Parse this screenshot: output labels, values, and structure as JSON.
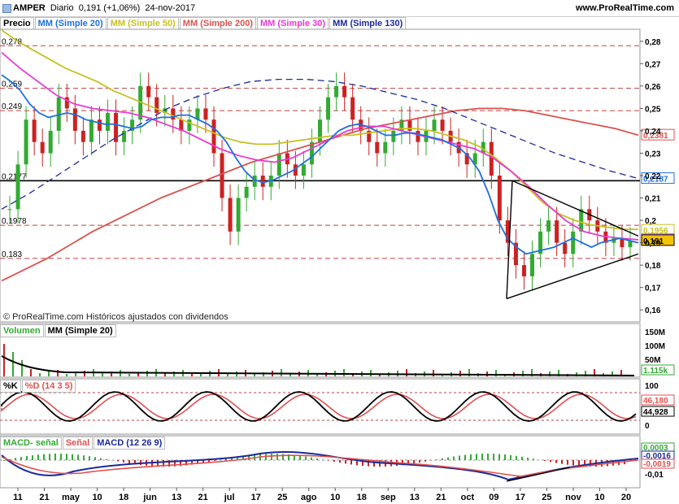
{
  "header": {
    "ticker": "AMPER",
    "period": "Diario",
    "last": "0,191 (+1,06%)",
    "date": "24-nov-2017",
    "site": "www.ProRealTime.com"
  },
  "copyright": "© ProRealTime.com  Históricos ajustados con dividendos",
  "colors": {
    "candle_up": "#33aa33",
    "candle_down": "#cc2222",
    "ma20": "#1f6fe0",
    "ma50": "#c8c020",
    "ma200": "#d9534f",
    "ma30": "#e83ad1",
    "ma130": "#1a2a9a"
  },
  "chart_data": [
    {
      "type": "candlestick",
      "title": "AMPER Diario",
      "legend": [
        "Precio",
        "MM (Simple 20)",
        "MM (Simple 50)",
        "MM (Simple 200)",
        "MM (Simple 30)",
        "MM (Simple 130)"
      ],
      "ylim": [
        0.155,
        0.285
      ],
      "yticks": [
        "0,28",
        "0,27",
        "0,26",
        "0,25",
        "0,24",
        "0,23",
        "0,22",
        "0,21",
        "0,2",
        "0,19",
        "0,18",
        "0,17",
        "0,16"
      ],
      "x_labels": [
        "11",
        "21",
        "may",
        "10",
        "18",
        "jun",
        "13",
        "21",
        "jul",
        "17",
        "25",
        "ago",
        "10",
        "18",
        "sep",
        "13",
        "21",
        "oct",
        "09",
        "17",
        "25",
        "nov",
        "10",
        "20"
      ],
      "h_levels": [
        {
          "value": 0.278,
          "label": "0,278",
          "style": "dashed"
        },
        {
          "value": 0.259,
          "label": "0,259",
          "style": "dashed"
        },
        {
          "value": 0.249,
          "label": "0,249",
          "style": "dashed"
        },
        {
          "value": 0.2177,
          "label": "0,2177",
          "style": "solid"
        },
        {
          "value": 0.1978,
          "label": "0,1978",
          "style": "dashed"
        },
        {
          "value": 0.183,
          "label": "0,183",
          "style": "dashed"
        }
      ],
      "right_tags": [
        {
          "value": 0.2381,
          "label": "0,2381"
        },
        {
          "value": 0.2187,
          "label": "0,2187"
        },
        {
          "value": 0.1956,
          "label": "0,1956"
        },
        {
          "value": 0.1914,
          "label": "0,1914"
        },
        {
          "value": 0.191,
          "label": "0,191"
        }
      ],
      "close": [
        0.205,
        0.225,
        0.245,
        0.235,
        0.23,
        0.24,
        0.255,
        0.25,
        0.24,
        0.235,
        0.245,
        0.24,
        0.248,
        0.235,
        0.24,
        0.245,
        0.26,
        0.255,
        0.248,
        0.25,
        0.245,
        0.24,
        0.245,
        0.25,
        0.245,
        0.23,
        0.21,
        0.195,
        0.21,
        0.215,
        0.22,
        0.215,
        0.22,
        0.23,
        0.225,
        0.22,
        0.225,
        0.235,
        0.245,
        0.255,
        0.26,
        0.255,
        0.245,
        0.24,
        0.235,
        0.23,
        0.235,
        0.24,
        0.245,
        0.24,
        0.235,
        0.24,
        0.245,
        0.24,
        0.235,
        0.23,
        0.225,
        0.23,
        0.235,
        0.22,
        0.2,
        0.19,
        0.18,
        0.175,
        0.185,
        0.195,
        0.2,
        0.19,
        0.185,
        0.195,
        0.205,
        0.2,
        0.195,
        0.19,
        0.192,
        0.188,
        0.191
      ],
      "ma20": [
        0.265,
        0.262,
        0.258,
        0.252,
        0.248,
        0.246,
        0.247,
        0.248,
        0.247,
        0.245,
        0.244,
        0.243,
        0.243,
        0.242,
        0.241,
        0.242,
        0.245,
        0.246,
        0.246,
        0.247,
        0.247,
        0.245,
        0.243,
        0.24,
        0.235,
        0.228,
        0.222,
        0.218,
        0.217,
        0.218,
        0.22,
        0.222,
        0.225,
        0.228,
        0.232,
        0.236,
        0.24,
        0.242,
        0.243,
        0.242,
        0.24,
        0.238,
        0.238,
        0.239,
        0.239,
        0.238,
        0.237,
        0.236,
        0.234,
        0.232,
        0.228,
        0.222,
        0.212,
        0.2,
        0.192,
        0.188,
        0.185,
        0.186,
        0.187,
        0.188,
        0.19,
        0.192,
        0.19,
        0.188,
        0.19,
        0.191,
        0.192,
        0.191,
        0.19
      ],
      "ma50": [
        0.285,
        0.28,
        0.276,
        0.272,
        0.268,
        0.265,
        0.262,
        0.258,
        0.255,
        0.252,
        0.249,
        0.246,
        0.243,
        0.24,
        0.237,
        0.235,
        0.234,
        0.234,
        0.235,
        0.236,
        0.237,
        0.238,
        0.238,
        0.239,
        0.24,
        0.241,
        0.241,
        0.24,
        0.238,
        0.236,
        0.233,
        0.228,
        0.222,
        0.215,
        0.208,
        0.203,
        0.2,
        0.198,
        0.197,
        0.196,
        0.196
      ],
      "ma200": [
        0.173,
        0.178,
        0.183,
        0.189,
        0.195,
        0.2,
        0.205,
        0.21,
        0.214,
        0.218,
        0.222,
        0.226,
        0.229,
        0.232,
        0.235,
        0.238,
        0.241,
        0.243,
        0.245,
        0.247,
        0.249,
        0.25,
        0.25,
        0.249,
        0.247,
        0.245,
        0.243,
        0.241,
        0.2381
      ],
      "ma30": [
        0.275,
        0.268,
        0.262,
        0.256,
        0.252,
        0.25,
        0.249,
        0.248,
        0.246,
        0.243,
        0.24,
        0.236,
        0.232,
        0.229,
        0.227,
        0.226,
        0.228,
        0.232,
        0.236,
        0.24,
        0.242,
        0.242,
        0.24,
        0.238,
        0.236,
        0.234,
        0.232,
        0.228,
        0.222,
        0.215,
        0.207,
        0.2,
        0.195,
        0.193,
        0.192,
        0.1914
      ],
      "ma130": [
        0.205,
        0.212,
        0.22,
        0.228,
        0.236,
        0.243,
        0.25,
        0.255,
        0.259,
        0.262,
        0.263,
        0.263,
        0.262,
        0.26,
        0.257,
        0.254,
        0.25,
        0.245,
        0.24,
        0.235,
        0.23,
        0.226,
        0.222,
        0.2187
      ]
    },
    {
      "type": "bar",
      "title": "Volumen",
      "legend": [
        "Volumen",
        "MM (Simple 20)"
      ],
      "yticks": [
        "150M",
        "100M",
        "50M"
      ],
      "last_tag": "1.115k"
    },
    {
      "type": "line",
      "title": "%K %D (14 3 5)",
      "legend": [
        "%K",
        "%D (14 3 5)"
      ],
      "yticks": [
        "100",
        "0"
      ],
      "right_tags": [
        "46,180",
        "44,928"
      ]
    },
    {
      "type": "bar",
      "title": "MACD",
      "legend": [
        "MACD- señal",
        "Señal",
        "MACD (12 26 9)"
      ],
      "yticks": [
        "0",
        "-0,01"
      ],
      "right_tags": [
        "0,0003",
        "-0,0016",
        "-0,0019"
      ]
    }
  ]
}
